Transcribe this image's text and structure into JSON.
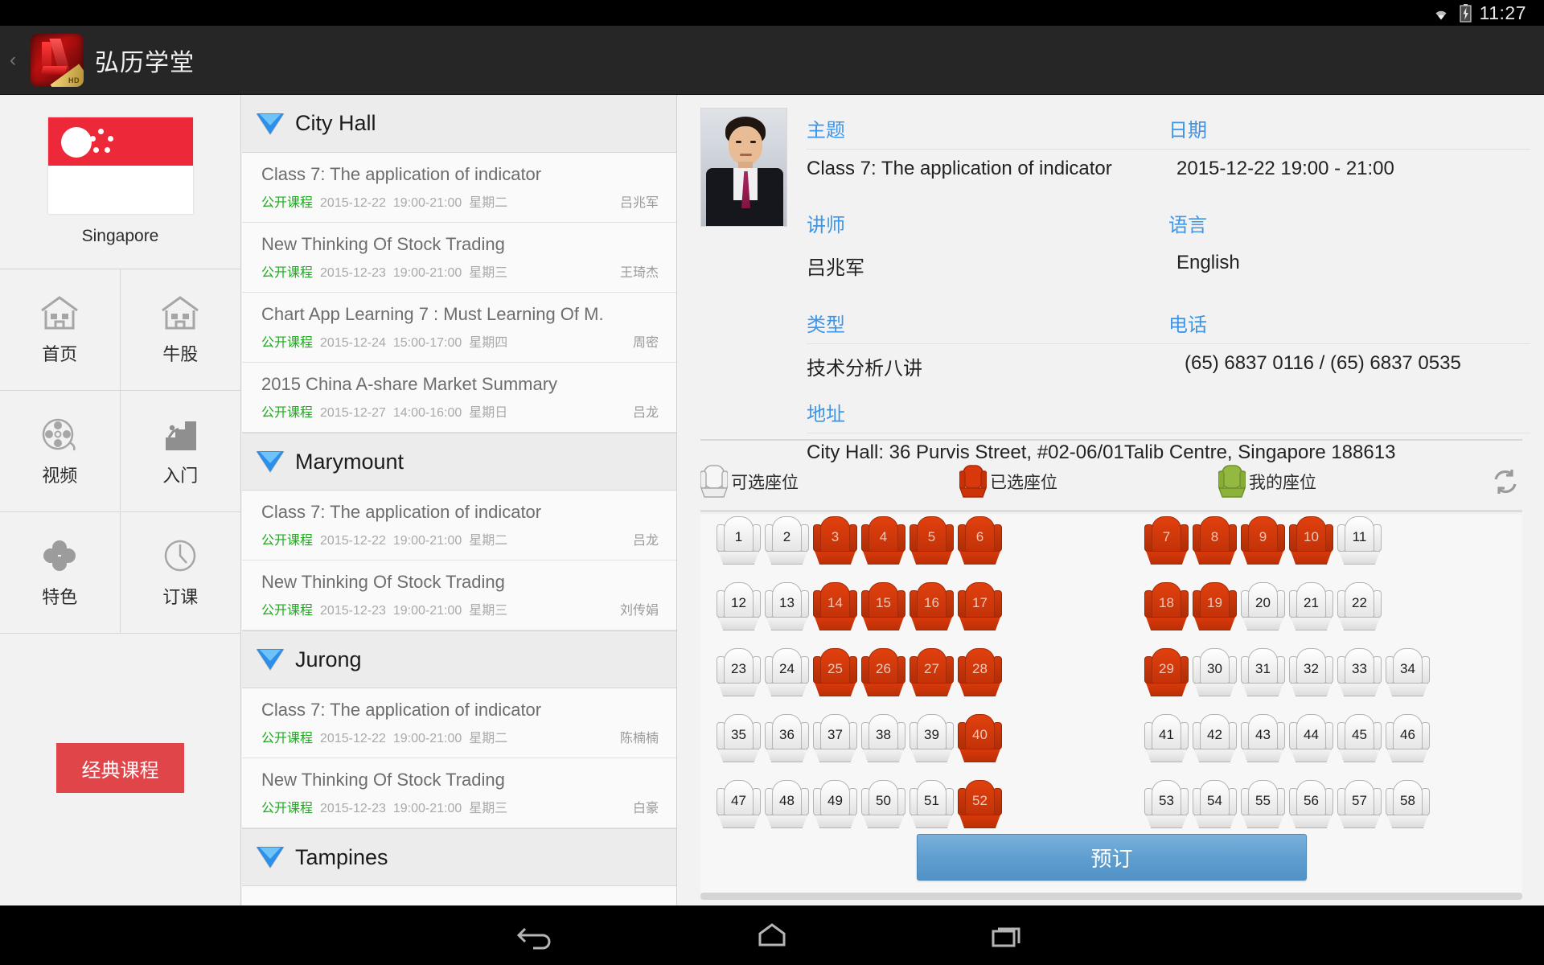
{
  "statusbar": {
    "time": "11:27",
    "wifi_icon": "wifi-icon",
    "battery_icon": "battery-charging-icon"
  },
  "appbar": {
    "title": "弘历学堂",
    "logo_text": "HD",
    "back_caret": "‹"
  },
  "sidebar": {
    "country": "Singapore",
    "flag": "singapore-flag",
    "nav_items": [
      {
        "label": "首页",
        "icon": "house-icon"
      },
      {
        "label": "牛股",
        "icon": "house-icon"
      },
      {
        "label": "视频",
        "icon": "film-reel-icon"
      },
      {
        "label": "入门",
        "icon": "stairs-climb-icon"
      },
      {
        "label": "特色",
        "icon": "clover-icon"
      },
      {
        "label": "订课",
        "icon": "clock-icon"
      }
    ],
    "classic_button": "经典课程"
  },
  "course_list": {
    "groups": [
      {
        "name": "City Hall",
        "expanded_icon": "triangle-down-icon",
        "courses": [
          {
            "title": "Class 7: The application of indicator",
            "tag": "公开课程",
            "date": "2015-12-22",
            "time": "19:00-21:00",
            "weekday": "星期二",
            "teacher": "吕兆军"
          },
          {
            "title": "New Thinking Of Stock Trading",
            "tag": "公开课程",
            "date": "2015-12-23",
            "time": "19:00-21:00",
            "weekday": "星期三",
            "teacher": "王琦杰"
          },
          {
            "title": "Chart App Learning 7 : Must Learning Of M.",
            "tag": "公开课程",
            "date": "2015-12-24",
            "time": "15:00-17:00",
            "weekday": "星期四",
            "teacher": "周密"
          },
          {
            "title": "2015 China A-share Market Summary",
            "tag": "公开课程",
            "date": "2015-12-27",
            "time": "14:00-16:00",
            "weekday": "星期日",
            "teacher": "吕龙"
          }
        ]
      },
      {
        "name": "Marymount",
        "expanded_icon": "triangle-down-icon",
        "courses": [
          {
            "title": "Class 7: The application of indicator",
            "tag": "公开课程",
            "date": "2015-12-22",
            "time": "19:00-21:00",
            "weekday": "星期二",
            "teacher": "吕龙"
          },
          {
            "title": "New Thinking Of Stock Trading",
            "tag": "公开课程",
            "date": "2015-12-23",
            "time": "19:00-21:00",
            "weekday": "星期三",
            "teacher": "刘传娟"
          }
        ]
      },
      {
        "name": "Jurong",
        "expanded_icon": "triangle-down-icon",
        "courses": [
          {
            "title": "Class 7: The application of indicator",
            "tag": "公开课程",
            "date": "2015-12-22",
            "time": "19:00-21:00",
            "weekday": "星期二",
            "teacher": "陈楠楠"
          },
          {
            "title": "New Thinking Of Stock Trading",
            "tag": "公开课程",
            "date": "2015-12-23",
            "time": "19:00-21:00",
            "weekday": "星期三",
            "teacher": "白豪"
          }
        ]
      },
      {
        "name": "Tampines",
        "expanded_icon": "triangle-down-icon",
        "courses": []
      }
    ]
  },
  "detail": {
    "photo_alt": "instructor-photo",
    "fields": {
      "topic_label": "主题",
      "topic_value": "Class 7: The application of indicator",
      "date_label": "日期",
      "date_value": "2015-12-22   19:00 - 21:00",
      "teacher_label": "讲师",
      "teacher_value": "吕兆军",
      "language_label": "语言",
      "language_value": "English",
      "type_label": "类型",
      "type_value": "技术分析八讲",
      "phone_label": "电话",
      "phone_value": "(65) 6837 0116 / (65) 6837 0535",
      "address_label": "地址",
      "address_value": "City Hall: 36 Purvis Street, #02-06/01Talib Centre, Singapore 188613"
    }
  },
  "seat_legend": {
    "available": "可选座位",
    "taken": "已选座位",
    "mine": "我的座位",
    "refresh_icon": "refresh-icon",
    "colors": {
      "available": "#f0f0f0",
      "taken": "#d9380c",
      "mine": "#93b940"
    }
  },
  "seat_map": {
    "rows": [
      {
        "left": [
          {
            "n": "1",
            "s": "free"
          },
          {
            "n": "2",
            "s": "free"
          },
          {
            "n": "3",
            "s": "taken"
          },
          {
            "n": "4",
            "s": "taken"
          },
          {
            "n": "5",
            "s": "taken"
          },
          {
            "n": "6",
            "s": "taken"
          }
        ],
        "right": [
          {
            "n": "7",
            "s": "taken"
          },
          {
            "n": "8",
            "s": "taken"
          },
          {
            "n": "9",
            "s": "taken"
          },
          {
            "n": "10",
            "s": "taken"
          },
          {
            "n": "11",
            "s": "free"
          }
        ]
      },
      {
        "left": [
          {
            "n": "12",
            "s": "free"
          },
          {
            "n": "13",
            "s": "free"
          },
          {
            "n": "14",
            "s": "taken"
          },
          {
            "n": "15",
            "s": "taken"
          },
          {
            "n": "16",
            "s": "taken"
          },
          {
            "n": "17",
            "s": "taken"
          }
        ],
        "right": [
          {
            "n": "18",
            "s": "taken"
          },
          {
            "n": "19",
            "s": "taken"
          },
          {
            "n": "20",
            "s": "free"
          },
          {
            "n": "21",
            "s": "free"
          },
          {
            "n": "22",
            "s": "free"
          }
        ]
      },
      {
        "left": [
          {
            "n": "23",
            "s": "free"
          },
          {
            "n": "24",
            "s": "free"
          },
          {
            "n": "25",
            "s": "taken"
          },
          {
            "n": "26",
            "s": "taken"
          },
          {
            "n": "27",
            "s": "taken"
          },
          {
            "n": "28",
            "s": "taken"
          }
        ],
        "right": [
          {
            "n": "29",
            "s": "taken"
          },
          {
            "n": "30",
            "s": "free"
          },
          {
            "n": "31",
            "s": "free"
          },
          {
            "n": "32",
            "s": "free"
          },
          {
            "n": "33",
            "s": "free"
          },
          {
            "n": "34",
            "s": "free"
          }
        ]
      },
      {
        "left": [
          {
            "n": "35",
            "s": "free"
          },
          {
            "n": "36",
            "s": "free"
          },
          {
            "n": "37",
            "s": "free"
          },
          {
            "n": "38",
            "s": "free"
          },
          {
            "n": "39",
            "s": "free"
          },
          {
            "n": "40",
            "s": "taken"
          }
        ],
        "right": [
          {
            "n": "41",
            "s": "free"
          },
          {
            "n": "42",
            "s": "free"
          },
          {
            "n": "43",
            "s": "free"
          },
          {
            "n": "44",
            "s": "free"
          },
          {
            "n": "45",
            "s": "free"
          },
          {
            "n": "46",
            "s": "free"
          }
        ]
      },
      {
        "left": [
          {
            "n": "47",
            "s": "free"
          },
          {
            "n": "48",
            "s": "free"
          },
          {
            "n": "49",
            "s": "free"
          },
          {
            "n": "50",
            "s": "free"
          },
          {
            "n": "51",
            "s": "free"
          },
          {
            "n": "52",
            "s": "taken"
          }
        ],
        "right": [
          {
            "n": "53",
            "s": "free"
          },
          {
            "n": "54",
            "s": "free"
          },
          {
            "n": "55",
            "s": "free"
          },
          {
            "n": "56",
            "s": "free"
          },
          {
            "n": "57",
            "s": "free"
          },
          {
            "n": "58",
            "s": "free"
          }
        ]
      }
    ]
  },
  "book_button": "预订",
  "navbar": {
    "back_icon": "back-arrow-icon",
    "home_icon": "home-icon",
    "recents_icon": "recent-apps-icon"
  }
}
